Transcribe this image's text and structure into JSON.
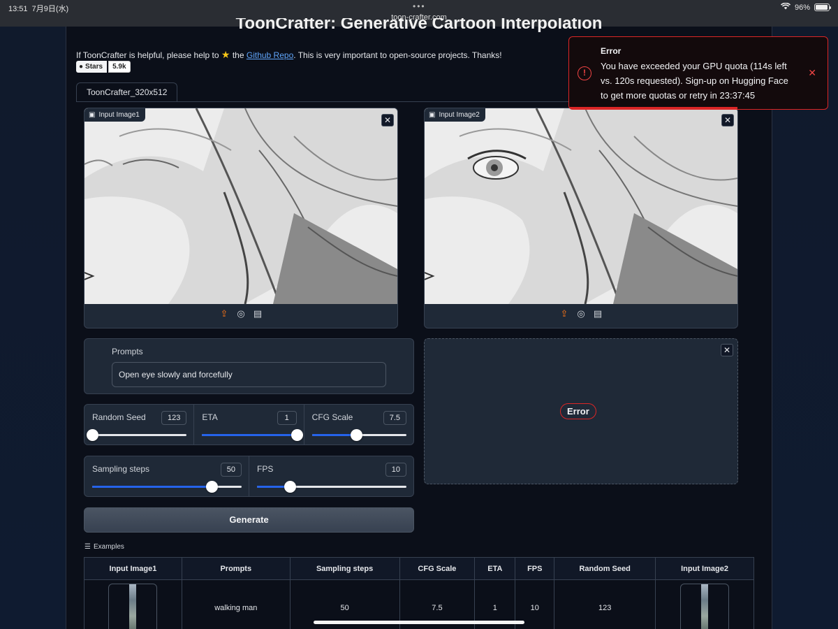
{
  "status_bar": {
    "time": "13:51",
    "date": "7月9日(水)",
    "url": "toon-crafter.com",
    "battery": "96%",
    "battery_level": 0.96
  },
  "page": {
    "title": "ToonCrafter: Generative Cartoon Interpolation",
    "intro_before": "If ToonCrafter is helpful, please help to",
    "intro_the": "the",
    "intro_link": "Github Repo",
    "intro_after": ". This is very important to open-source projects. Thanks!",
    "badge_label": "Stars",
    "badge_count": "5.9k",
    "tab": "ToonCrafter_320x512"
  },
  "inputs": {
    "image1_label": "Input Image1",
    "image2_label": "Input Image2",
    "prompts_label": "Prompts",
    "prompts_value": "Open eye slowly and forcefully"
  },
  "sliders": {
    "seed": {
      "label": "Random Seed",
      "value": "123",
      "fraction": 0.0
    },
    "eta": {
      "label": "ETA",
      "value": "1",
      "fraction": 1.0
    },
    "cfg": {
      "label": "CFG Scale",
      "value": "7.5",
      "fraction": 0.47
    },
    "steps": {
      "label": "Sampling steps",
      "value": "50",
      "fraction": 0.8
    },
    "fps": {
      "label": "FPS",
      "value": "10",
      "fraction": 0.22
    }
  },
  "generate_label": "Generate",
  "output": {
    "error_label": "Error"
  },
  "examples": {
    "label": "Examples",
    "headers": [
      "Input Image1",
      "Prompts",
      "Sampling steps",
      "CFG Scale",
      "ETA",
      "FPS",
      "Random Seed",
      "Input Image2"
    ],
    "rows": [
      {
        "prompt": "walking man",
        "steps": "50",
        "cfg": "7.5",
        "eta": "1",
        "fps": "10",
        "seed": "123"
      }
    ]
  },
  "toast": {
    "title": "Error",
    "message": "You have exceeded your GPU quota (114s left vs. 120s requested). Sign-up on Hugging Face to get more quotas or retry in 23:37:45",
    "progress": 0.65
  },
  "colors": {
    "accent": "#2563eb",
    "error": "#dc2626",
    "background": "#0b0f19"
  }
}
